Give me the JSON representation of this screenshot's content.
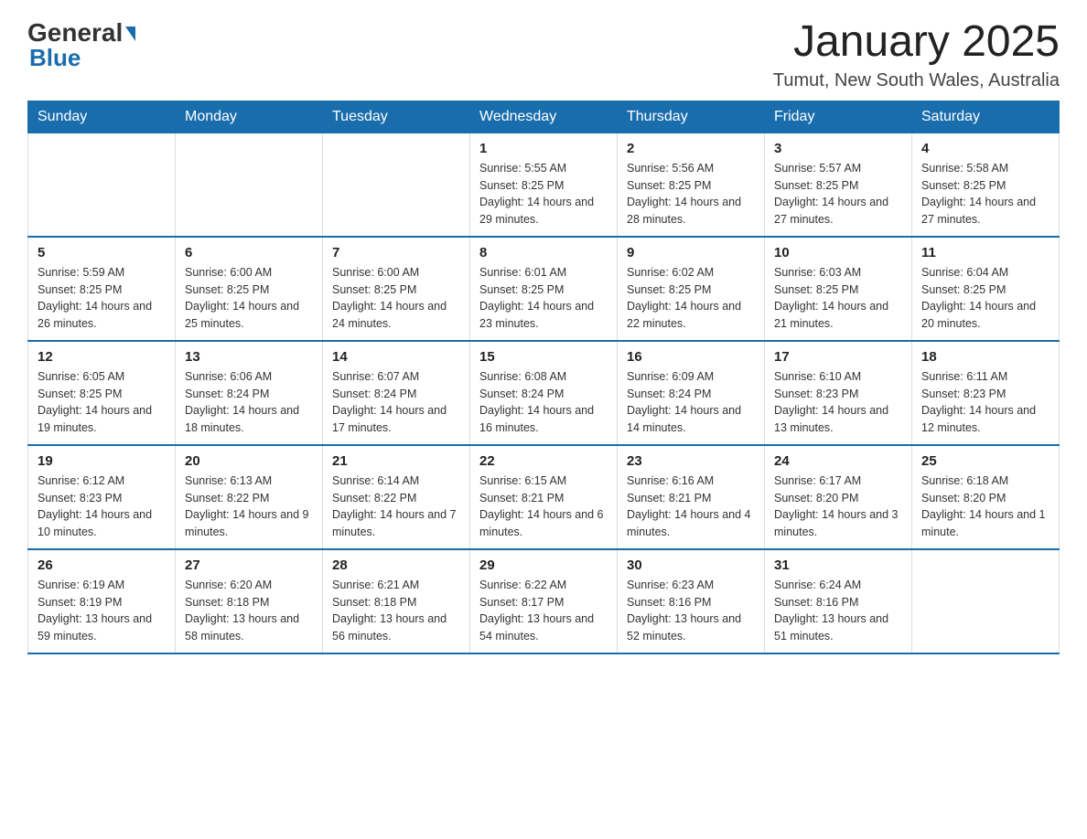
{
  "header": {
    "logo": {
      "general": "General",
      "triangle_alt": "blue triangle",
      "blue": "Blue"
    },
    "title": "January 2025",
    "subtitle": "Tumut, New South Wales, Australia"
  },
  "calendar": {
    "days": [
      "Sunday",
      "Monday",
      "Tuesday",
      "Wednesday",
      "Thursday",
      "Friday",
      "Saturday"
    ],
    "weeks": [
      [
        {
          "day": "",
          "info": ""
        },
        {
          "day": "",
          "info": ""
        },
        {
          "day": "",
          "info": ""
        },
        {
          "day": "1",
          "info": "Sunrise: 5:55 AM\nSunset: 8:25 PM\nDaylight: 14 hours and 29 minutes."
        },
        {
          "day": "2",
          "info": "Sunrise: 5:56 AM\nSunset: 8:25 PM\nDaylight: 14 hours and 28 minutes."
        },
        {
          "day": "3",
          "info": "Sunrise: 5:57 AM\nSunset: 8:25 PM\nDaylight: 14 hours and 27 minutes."
        },
        {
          "day": "4",
          "info": "Sunrise: 5:58 AM\nSunset: 8:25 PM\nDaylight: 14 hours and 27 minutes."
        }
      ],
      [
        {
          "day": "5",
          "info": "Sunrise: 5:59 AM\nSunset: 8:25 PM\nDaylight: 14 hours and 26 minutes."
        },
        {
          "day": "6",
          "info": "Sunrise: 6:00 AM\nSunset: 8:25 PM\nDaylight: 14 hours and 25 minutes."
        },
        {
          "day": "7",
          "info": "Sunrise: 6:00 AM\nSunset: 8:25 PM\nDaylight: 14 hours and 24 minutes."
        },
        {
          "day": "8",
          "info": "Sunrise: 6:01 AM\nSunset: 8:25 PM\nDaylight: 14 hours and 23 minutes."
        },
        {
          "day": "9",
          "info": "Sunrise: 6:02 AM\nSunset: 8:25 PM\nDaylight: 14 hours and 22 minutes."
        },
        {
          "day": "10",
          "info": "Sunrise: 6:03 AM\nSunset: 8:25 PM\nDaylight: 14 hours and 21 minutes."
        },
        {
          "day": "11",
          "info": "Sunrise: 6:04 AM\nSunset: 8:25 PM\nDaylight: 14 hours and 20 minutes."
        }
      ],
      [
        {
          "day": "12",
          "info": "Sunrise: 6:05 AM\nSunset: 8:25 PM\nDaylight: 14 hours and 19 minutes."
        },
        {
          "day": "13",
          "info": "Sunrise: 6:06 AM\nSunset: 8:24 PM\nDaylight: 14 hours and 18 minutes."
        },
        {
          "day": "14",
          "info": "Sunrise: 6:07 AM\nSunset: 8:24 PM\nDaylight: 14 hours and 17 minutes."
        },
        {
          "day": "15",
          "info": "Sunrise: 6:08 AM\nSunset: 8:24 PM\nDaylight: 14 hours and 16 minutes."
        },
        {
          "day": "16",
          "info": "Sunrise: 6:09 AM\nSunset: 8:24 PM\nDaylight: 14 hours and 14 minutes."
        },
        {
          "day": "17",
          "info": "Sunrise: 6:10 AM\nSunset: 8:23 PM\nDaylight: 14 hours and 13 minutes."
        },
        {
          "day": "18",
          "info": "Sunrise: 6:11 AM\nSunset: 8:23 PM\nDaylight: 14 hours and 12 minutes."
        }
      ],
      [
        {
          "day": "19",
          "info": "Sunrise: 6:12 AM\nSunset: 8:23 PM\nDaylight: 14 hours and 10 minutes."
        },
        {
          "day": "20",
          "info": "Sunrise: 6:13 AM\nSunset: 8:22 PM\nDaylight: 14 hours and 9 minutes."
        },
        {
          "day": "21",
          "info": "Sunrise: 6:14 AM\nSunset: 8:22 PM\nDaylight: 14 hours and 7 minutes."
        },
        {
          "day": "22",
          "info": "Sunrise: 6:15 AM\nSunset: 8:21 PM\nDaylight: 14 hours and 6 minutes."
        },
        {
          "day": "23",
          "info": "Sunrise: 6:16 AM\nSunset: 8:21 PM\nDaylight: 14 hours and 4 minutes."
        },
        {
          "day": "24",
          "info": "Sunrise: 6:17 AM\nSunset: 8:20 PM\nDaylight: 14 hours and 3 minutes."
        },
        {
          "day": "25",
          "info": "Sunrise: 6:18 AM\nSunset: 8:20 PM\nDaylight: 14 hours and 1 minute."
        }
      ],
      [
        {
          "day": "26",
          "info": "Sunrise: 6:19 AM\nSunset: 8:19 PM\nDaylight: 13 hours and 59 minutes."
        },
        {
          "day": "27",
          "info": "Sunrise: 6:20 AM\nSunset: 8:18 PM\nDaylight: 13 hours and 58 minutes."
        },
        {
          "day": "28",
          "info": "Sunrise: 6:21 AM\nSunset: 8:18 PM\nDaylight: 13 hours and 56 minutes."
        },
        {
          "day": "29",
          "info": "Sunrise: 6:22 AM\nSunset: 8:17 PM\nDaylight: 13 hours and 54 minutes."
        },
        {
          "day": "30",
          "info": "Sunrise: 6:23 AM\nSunset: 8:16 PM\nDaylight: 13 hours and 52 minutes."
        },
        {
          "day": "31",
          "info": "Sunrise: 6:24 AM\nSunset: 8:16 PM\nDaylight: 13 hours and 51 minutes."
        },
        {
          "day": "",
          "info": ""
        }
      ]
    ]
  }
}
